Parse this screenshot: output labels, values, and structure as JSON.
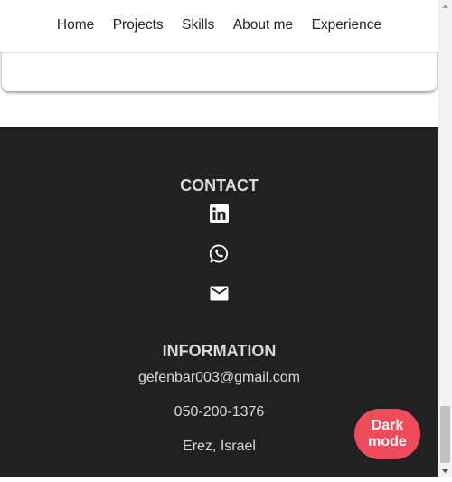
{
  "nav": {
    "items": [
      {
        "label": "Home"
      },
      {
        "label": "Projects"
      },
      {
        "label": "Skills"
      },
      {
        "label": "About me"
      },
      {
        "label": "Experience"
      }
    ]
  },
  "footer": {
    "contact_title": "CONTACT",
    "contact_icons": [
      "linkedin-icon",
      "whatsapp-icon",
      "mail-icon"
    ],
    "information_title": "INFORMATION",
    "email": "gefenbar003@gmail.com",
    "phone": "050-200-1376",
    "location": "Erez, Israel"
  },
  "dark_mode_button": {
    "line1": "Dark",
    "line2": "mode"
  },
  "colors": {
    "footer_bg": "#222121",
    "footer_text": "#d9d9d9",
    "accent": "#ef4b5b"
  }
}
